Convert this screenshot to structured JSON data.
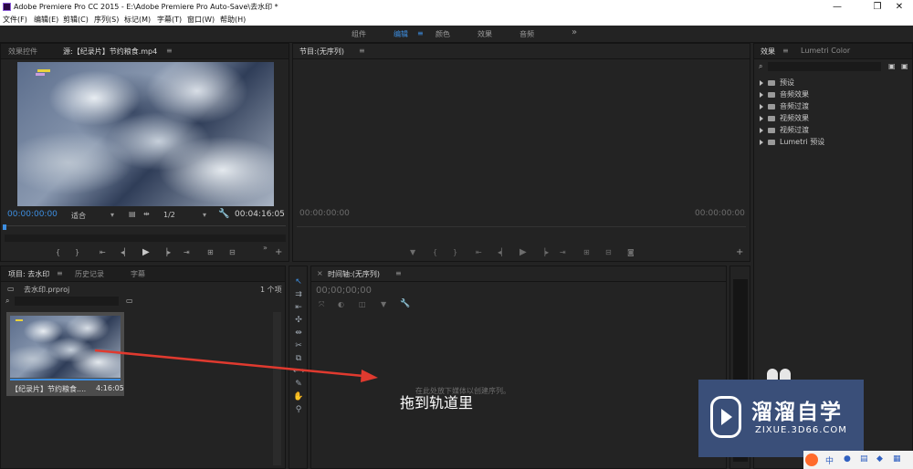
{
  "app": {
    "title": "Adobe Premiere Pro CC 2015 - E:\\Adobe Premiere Pro Auto-Save\\去水印 *",
    "window_controls": [
      "—",
      "❐",
      "✕"
    ]
  },
  "menu": [
    "文件(F)",
    "编辑(E)",
    "剪辑(C)",
    "序列(S)",
    "标记(M)",
    "字幕(T)",
    "窗口(W)",
    "帮助(H)"
  ],
  "workspaces": {
    "items": [
      "组件",
      "编辑",
      "颜色",
      "效果",
      "音频"
    ],
    "active": "编辑",
    "more": "»"
  },
  "source_monitor": {
    "tabs": [
      "效果控件",
      "源:【纪录片】节约粮食.mp4"
    ],
    "timecode_in": "00:00:00:00",
    "fit": "适合",
    "resolution": "1/2",
    "duration": "00:04:16:05"
  },
  "program_monitor": {
    "tab": "节目:(无序列)",
    "timecode_left": "00:00:00:00",
    "timecode_right": "00:00:00:00"
  },
  "effects_panel": {
    "tabs": [
      "效果",
      "Lumetri Color"
    ],
    "items": [
      "预设",
      "音频效果",
      "音频过渡",
      "视频效果",
      "视频过渡",
      "Lumetri 预设"
    ]
  },
  "project_panel": {
    "tabs": [
      "项目: 去水印",
      "历史记录",
      "字幕"
    ],
    "filename": "去水印.prproj",
    "count": "1 个项",
    "clip_name": "【纪录片】节约粮食....",
    "clip_duration": "4:16:05"
  },
  "timeline": {
    "tab": "时间轴:(无序列)",
    "timecode": "00;00;00;00",
    "drop_hint": "在此处放下媒体以创建序列。"
  },
  "annotation": {
    "text": "拖到轨道里",
    "arrow_color": "#e03a2f"
  },
  "watermark": {
    "brand": "溜溜自学",
    "url": "ZIXUE.3D66.COM",
    "bg_color": "#3a4f79"
  }
}
